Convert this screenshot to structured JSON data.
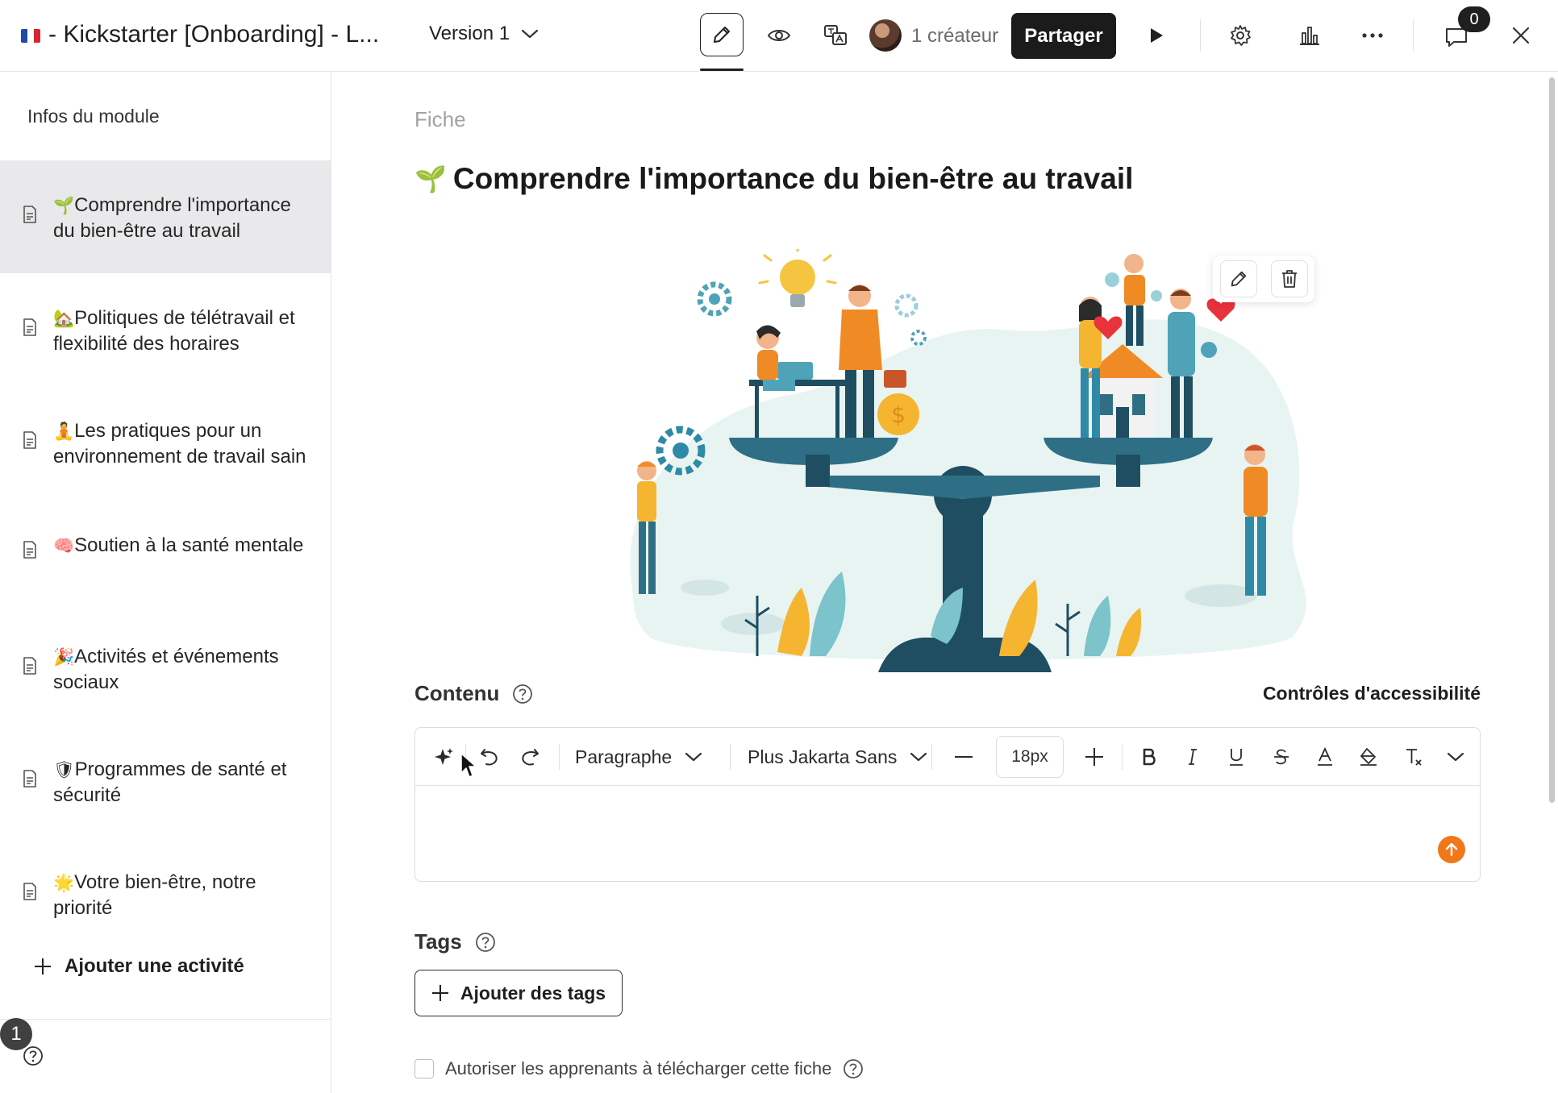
{
  "topbar": {
    "title": "- Kickstarter [Onboarding] - L...",
    "version_label": "Version 1",
    "creator_label": "1 créateur",
    "share_label": "Partager",
    "comments_count": "0"
  },
  "sidebar": {
    "module_info": "Infos du module",
    "items": [
      {
        "emoji": "🌱",
        "label": "Comprendre l'importance du bien-être au travail"
      },
      {
        "emoji": "🏡",
        "label": "Politiques de télétravail et flexibilité des horaires"
      },
      {
        "emoji": "🧘",
        "label": "Les pratiques pour un environnement de travail sain"
      },
      {
        "emoji": "🧠",
        "label": "Soutien à la santé mentale"
      },
      {
        "emoji": "🎉",
        "label": "Activités et événements sociaux"
      },
      {
        "emoji": "🛡",
        "label": "Programmes de santé et sécurité"
      },
      {
        "emoji": "🌟",
        "label": "Votre bien-être, notre priorité"
      }
    ],
    "add_activity": "Ajouter une activité",
    "notifications_count": "1"
  },
  "main": {
    "section_label": "Fiche",
    "title_emoji": "🌱",
    "title": "Comprendre l'importance du bien-être au travail",
    "content_label": "Contenu",
    "accessibility_link": "Contrôles d'accessibilité",
    "editor": {
      "block_type": "Paragraphe",
      "font_family": "Plus Jakarta Sans",
      "font_size": "18px"
    },
    "tags_label": "Tags",
    "add_tags": "Ajouter des tags",
    "download_option": "Autoriser les apprenants à télécharger cette fiche"
  },
  "colors": {
    "accent_orange": "#f0771a",
    "teal": "#2e6f86",
    "share_button_bg": "#1b1b1b",
    "active_item_bg": "#e9e9eb"
  }
}
